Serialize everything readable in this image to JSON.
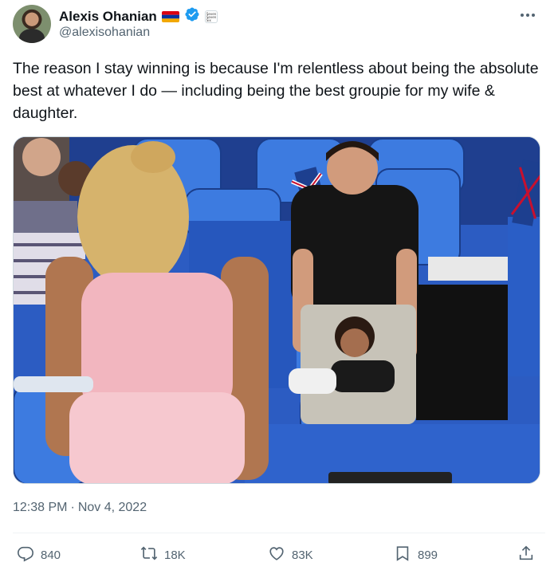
{
  "author": {
    "display_name": "Alexis Ohanian",
    "handle": "@alexisohanian",
    "verified": true,
    "flag": "armenia-flag",
    "affiliation_badge_text": "Seven Seven Six"
  },
  "tweet": {
    "text": "The reason I stay winning is because I'm relentless about being the absolute best at whatever I do — including being the best groupie for my wife & daughter.",
    "time": "12:38 PM",
    "separator": "·",
    "date": "Nov 4, 2022"
  },
  "actions": {
    "replies": "840",
    "retweets": "18K",
    "likes": "83K",
    "bookmarks": "899"
  },
  "colors": {
    "text_primary": "#0f1419",
    "text_secondary": "#536471",
    "verified_blue": "#1d9bf0",
    "border": "#cfd9de"
  },
  "icons": [
    "more-icon",
    "verified-icon",
    "reply-icon",
    "retweet-icon",
    "like-icon",
    "bookmark-icon",
    "share-icon"
  ]
}
